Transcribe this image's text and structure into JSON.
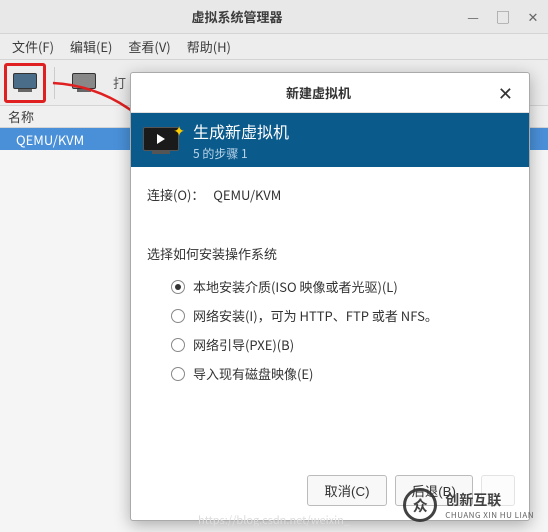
{
  "main_window": {
    "title": "虚拟系统管理器",
    "menu": {
      "file": "文件(F)",
      "edit": "编辑(E)",
      "view": "查看(V)",
      "help": "帮助(H)"
    },
    "toolbar": {
      "open_label": "打"
    },
    "list": {
      "header_name": "名称",
      "row_hypervisor": "QEMU/KVM"
    }
  },
  "dialog": {
    "title": "新建虚拟机",
    "header_title": "生成新虚拟机",
    "step_text": "5 的步骤 1",
    "connection_label": "连接(O)：",
    "connection_value": "QEMU/KVM",
    "install_section_label": "选择如何安装操作系统",
    "options": {
      "local_iso": "本地安装介质(ISO 映像或者光驱)(L)",
      "network": "网络安装(I)，可为 HTTP、FTP 或者 NFS。",
      "pxe": "网络引导(PXE)(B)",
      "import": "导入现有磁盘映像(E)"
    },
    "buttons": {
      "cancel": "取消(C)",
      "back": "后退(B)",
      "forward": ""
    }
  },
  "watermark": {
    "logo_text": "众",
    "cn": "创新互联",
    "en": "CHUANG XIN HU LIAN",
    "url": "https://blog.csdn.net/weixin_"
  }
}
